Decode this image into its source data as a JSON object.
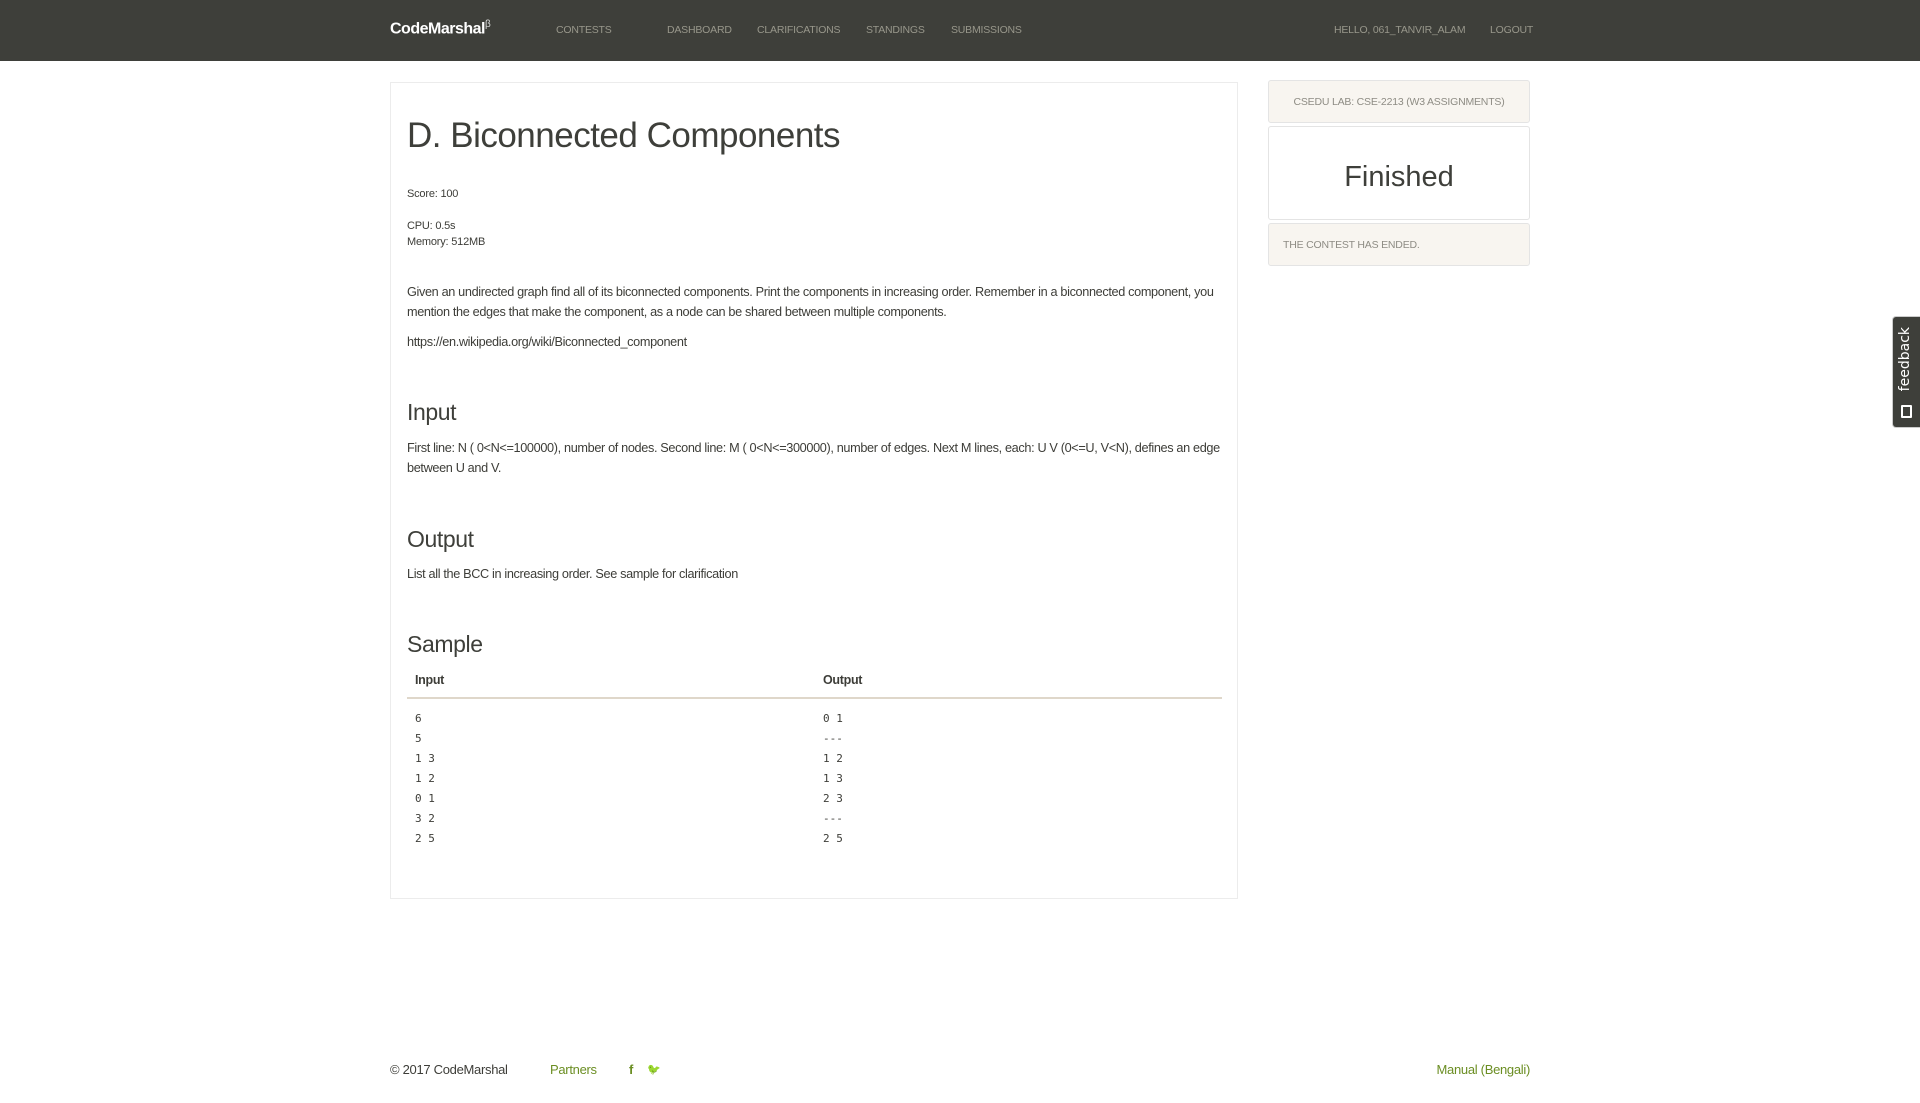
{
  "nav": {
    "logo": "CodeMarshal",
    "beta": "β",
    "items": [
      "CONTESTS",
      "DASHBOARD",
      "CLARIFICATIONS",
      "STANDINGS",
      "SUBMISSIONS"
    ],
    "user": "HELLO, 061_TANVIR_ALAM",
    "logout": "LOGOUT"
  },
  "problem": {
    "title": "D. Biconnected Components",
    "score": "Score: 100",
    "cpu": "CPU: 0.5s",
    "memory": "Memory: 512MB",
    "description": "Given an undirected graph find all of its biconnected components. Print the components in increasing order. Remember in a biconnected component, you mention the edges that make the component, as a node can be shared between multiple components.",
    "link": "https://en.wikipedia.org/wiki/Biconnected_component",
    "input_heading": "Input",
    "input_text": "First line: N ( 0<N<=100000), number of nodes. Second line: M ( 0<N<=300000), number of edges. Next M lines, each: U V (0<=U, V<N), defines an edge between U and V.",
    "output_heading": "Output",
    "output_text": "List all the BCC in increasing order. See sample for clarification",
    "sample_heading": "Sample",
    "sample_input_label": "Input",
    "sample_output_label": "Output",
    "sample_input": "6\n5\n1 3\n1 2\n0 1\n3 2\n2 5",
    "sample_output": "0 1\n---\n1 2\n1 3\n2 3\n---\n2 5"
  },
  "sidebar": {
    "contest": "CSEDU LAB: CSE-2213 (W3 ASSIGNMENTS)",
    "status": "Finished",
    "message": "THE CONTEST HAS ENDED."
  },
  "feedback": "feedback",
  "footer": {
    "copyright": "© 2017 CodeMarshal",
    "partners": "Partners",
    "facebook": "f",
    "twitter": "🐦",
    "manual": "Manual (Bengali)"
  }
}
